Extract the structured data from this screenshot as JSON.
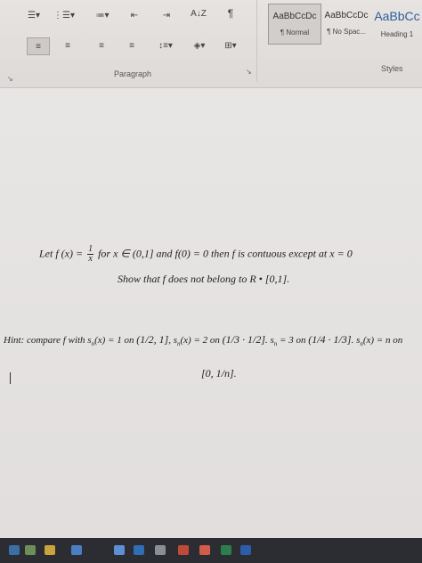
{
  "ribbon": {
    "paragraph_label": "Paragraph",
    "styles_label": "Styles",
    "sort_glyph": "A↓Z",
    "pilcrow_glyph": "¶",
    "styles": [
      {
        "sample": "AaBbCcDc",
        "name": "¶ Normal"
      },
      {
        "sample": "AaBbCcDc",
        "name": "¶ No Spac..."
      },
      {
        "sample": "AaBbCc",
        "name": "Heading 1"
      }
    ]
  },
  "document": {
    "line1_a": "Let f (x) =",
    "frac_num": "1",
    "frac_den": "x",
    "line1_b": "for x ∈ (0,1] and f(0) = 0 then f is contuous except at x = 0",
    "line2": "Show that f does not belong to R • [0,1].",
    "hint_a": "Hint: compare f with s",
    "hint_sub": "n",
    "hint_b": "(x) = 1 on",
    "int1": "(1/2, 1]",
    "hint_c": ", s",
    "hint_d": "(x) = 2  on",
    "int2": "(1/3 · 1/2]",
    "hint_e": ". s",
    "hint_f": "= 3 on",
    "int3": "(1/4 · 1/3]",
    "hint_g": ". s",
    "hint_h": "(x) = n on",
    "int4": "[0, 1/n]."
  },
  "colors": {
    "heading_blue": "#2f5f9a",
    "page": "#e6e4e3",
    "taskbar": "#2b2d32"
  }
}
